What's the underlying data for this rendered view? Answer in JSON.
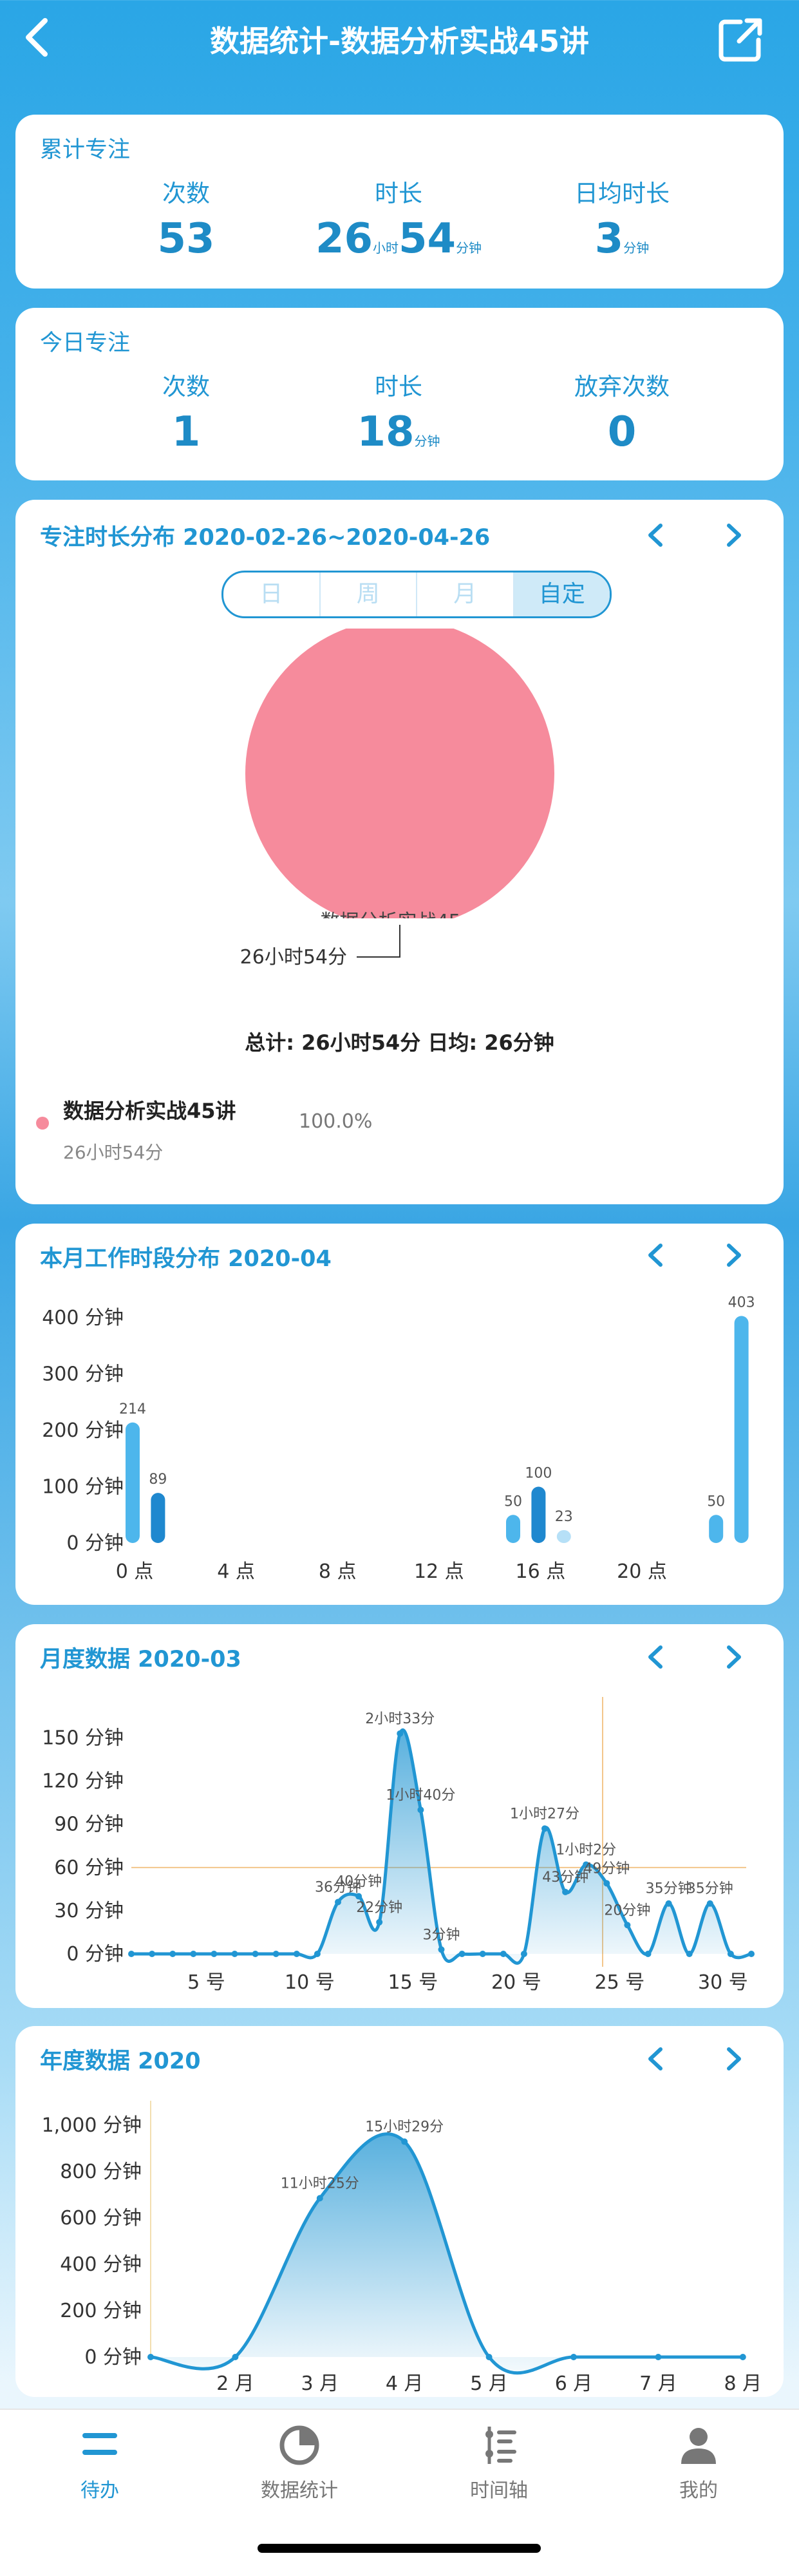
{
  "header": {
    "title": "数据统计-数据分析实战45讲"
  },
  "cumulative": {
    "title": "累计专注",
    "count_label": "次数",
    "count_value": "53",
    "duration_label": "时长",
    "duration_hours": "26",
    "hours_unit": "小时",
    "duration_minutes": "54",
    "minutes_unit": "分钟",
    "daily_label": "日均时长",
    "daily_value": "3",
    "daily_unit": "分钟"
  },
  "today": {
    "title": "今日专注",
    "count_label": "次数",
    "count_value": "1",
    "duration_label": "时长",
    "duration_value": "18",
    "duration_unit": "分钟",
    "abandon_label": "放弃次数",
    "abandon_value": "0"
  },
  "distribution": {
    "title": "专注时长分布 2020-02-26~2020-04-26",
    "segments": [
      "日",
      "周",
      "月",
      "自定"
    ],
    "pie_label": "数据分析实战45...",
    "pie_value_label": "26小时54分",
    "total_text": "总计: 26小时54分  日均: 26分钟",
    "legend_name": "数据分析实战45讲",
    "legend_duration": "26小时54分",
    "legend_percent": "100.0%",
    "pie_color": "#f68b9c"
  },
  "chart_data": [
    {
      "type": "bar",
      "title": "本月工作时段分布  2020-04",
      "ylim": [
        0,
        420
      ],
      "y_ticks": [
        "0 分钟",
        "100 分钟",
        "200 分钟",
        "300 分钟",
        "400 分钟"
      ],
      "x_ticks": [
        "0 点",
        "4 点",
        "8 点",
        "12 点",
        "16 点",
        "20 点"
      ],
      "hours": [
        0,
        1,
        15,
        16,
        17,
        23,
        24
      ],
      "values": [
        214,
        89,
        50,
        100,
        23,
        50,
        403
      ],
      "labels": [
        "214",
        "89",
        "50",
        "100",
        "23",
        "50",
        "403"
      ]
    },
    {
      "type": "area",
      "title": "月度数据 2020-03",
      "ylim": [
        0,
        165
      ],
      "y_ticks": [
        "0 分钟",
        "30 分钟",
        "60 分钟",
        "90 分钟",
        "120 分钟",
        "150 分钟"
      ],
      "x_ticks": [
        "5 号",
        "10 号",
        "15 号",
        "20 号",
        "25 号",
        "30 号"
      ],
      "x": [
        1,
        2,
        3,
        4,
        5,
        6,
        7,
        8,
        9,
        10,
        11,
        12,
        13,
        14,
        15,
        16,
        17,
        18,
        19,
        20,
        21,
        22,
        23,
        24,
        25,
        26,
        27,
        28,
        29,
        30,
        31
      ],
      "values": [
        0,
        0,
        0,
        0,
        0,
        0,
        0,
        0,
        0,
        0,
        36,
        40,
        22,
        153,
        100,
        3,
        0,
        0,
        0,
        0,
        87,
        43,
        62,
        49,
        20,
        0,
        35,
        0,
        35,
        0,
        0
      ],
      "point_labels": [
        "",
        "",
        "",
        "",
        "",
        "",
        "",
        "",
        "",
        "",
        "36分钟",
        "40分钟",
        "22分钟",
        "2小时33分",
        "1小时40分",
        "3分钟",
        "",
        "",
        "",
        "",
        "1小时27分",
        "43分钟",
        "1小时2分",
        "49分钟",
        "20分钟",
        "",
        "35分钟",
        "",
        "35分钟",
        "",
        ""
      ],
      "average_line": 60
    },
    {
      "type": "area",
      "title": "年度数据  2020",
      "ylim": [
        0,
        1050
      ],
      "y_ticks": [
        "0 分钟",
        "200 分钟",
        "400 分钟",
        "600 分钟",
        "800 分钟",
        "1,000 分钟"
      ],
      "x_ticks": [
        "2 月",
        "3 月",
        "4 月",
        "5 月",
        "6 月",
        "7 月",
        "8 月"
      ],
      "x": [
        1,
        2,
        3,
        4,
        5,
        6,
        7,
        8
      ],
      "values": [
        0,
        0,
        685,
        929,
        0,
        0,
        0,
        0
      ],
      "point_labels": [
        "",
        "",
        "11小时25分",
        "15小时29分",
        "",
        "",
        "",
        ""
      ]
    }
  ],
  "tabbar": {
    "items": [
      {
        "label": "待办",
        "icon": "todo-icon",
        "active": true
      },
      {
        "label": "数据统计",
        "icon": "pie-chart-icon"
      },
      {
        "label": "时间轴",
        "icon": "timeline-icon"
      },
      {
        "label": "我的",
        "icon": "profile-icon"
      }
    ],
    "active_color": "#2196d3"
  }
}
